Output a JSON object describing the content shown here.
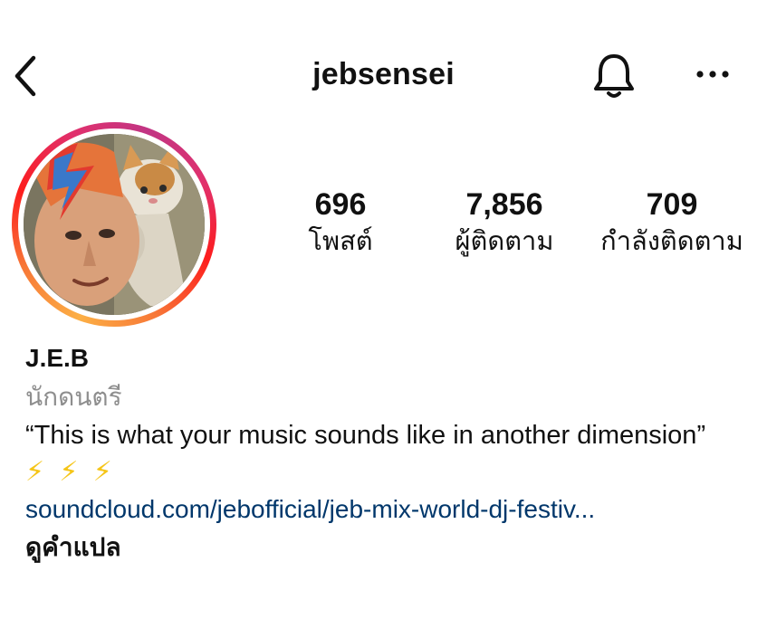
{
  "header": {
    "username": "jebsensei",
    "back_icon": "chevron-left-icon",
    "bell_icon": "bell-icon",
    "more_icon": "more-horizontal-icon"
  },
  "profile": {
    "avatar_ring_colors": [
      "#fcaf45",
      "#f77737",
      "#fd1d1d",
      "#e1306c",
      "#c13584"
    ],
    "stats": [
      {
        "count": "696",
        "label": "โพสต์"
      },
      {
        "count": "7,856",
        "label": "ผู้ติดตาม"
      },
      {
        "count": "709",
        "label": "กำลังติดตาม"
      }
    ]
  },
  "bio": {
    "name": "J.E.B",
    "category": "นักดนตรี",
    "text": "“This is what your music sounds like in another dimension”",
    "emoji": "⚡ ⚡ ⚡",
    "link": "soundcloud.com/jebofficial/jeb-mix-world-dj-festiv...",
    "translate": "ดูคำแปล"
  },
  "colors": {
    "link": "#00376b",
    "category": "#8e8e8e",
    "text": "#111111"
  }
}
